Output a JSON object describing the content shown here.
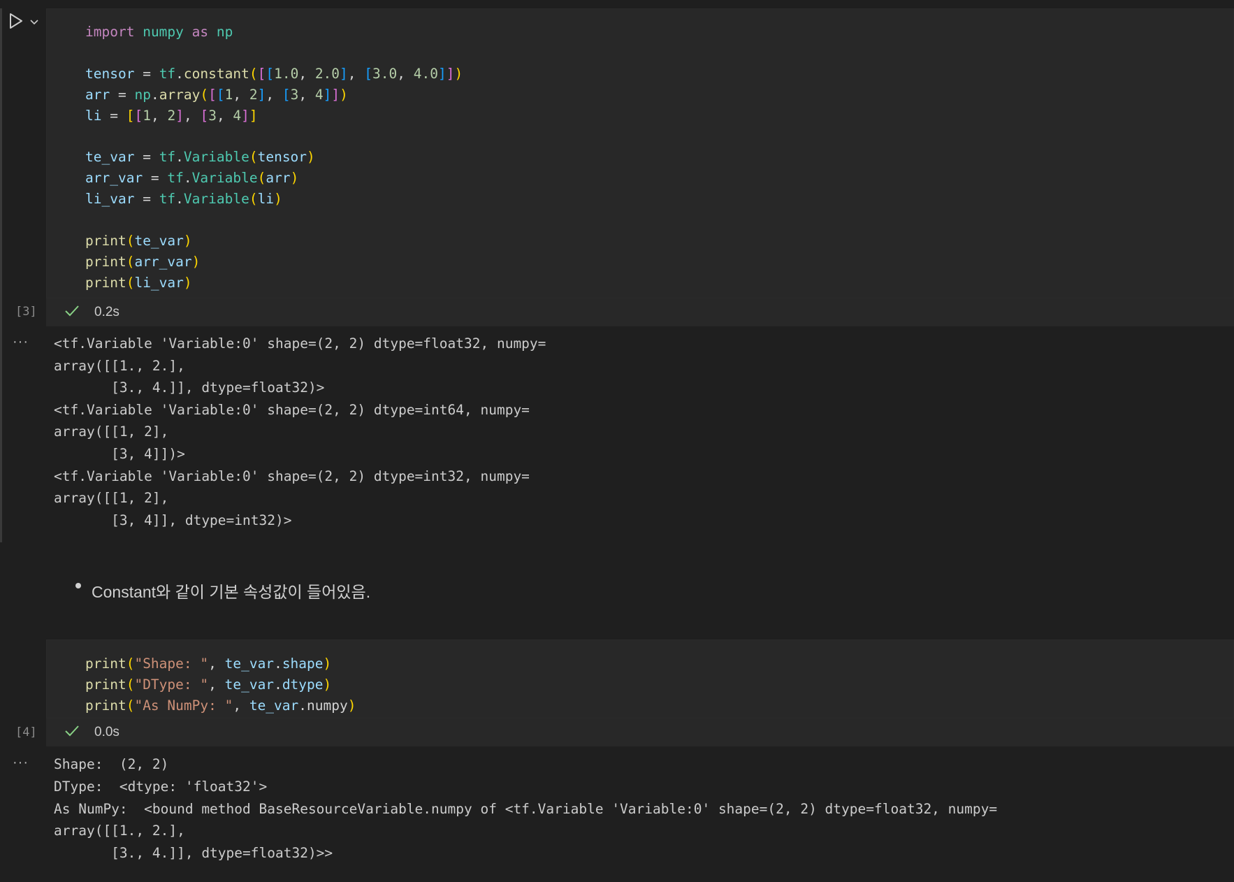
{
  "cell3": {
    "code": [
      {
        "segments": [
          [
            "kw",
            "import"
          ],
          [
            "op",
            " "
          ],
          [
            "mod",
            "numpy"
          ],
          [
            "op",
            " "
          ],
          [
            "kw",
            "as"
          ],
          [
            "op",
            " "
          ],
          [
            "mod",
            "np"
          ]
        ]
      },
      {
        "segments": []
      },
      {
        "segments": [
          [
            "var",
            "tensor"
          ],
          [
            "op",
            " = "
          ],
          [
            "mod",
            "tf"
          ],
          [
            "op",
            "."
          ],
          [
            "fn",
            "constant"
          ],
          [
            "b1",
            "("
          ],
          [
            "b2",
            "["
          ],
          [
            "b3",
            "["
          ],
          [
            "num",
            "1.0"
          ],
          [
            "op",
            ", "
          ],
          [
            "num",
            "2.0"
          ],
          [
            "b3",
            "]"
          ],
          [
            "op",
            ", "
          ],
          [
            "b3",
            "["
          ],
          [
            "num",
            "3.0"
          ],
          [
            "op",
            ", "
          ],
          [
            "num",
            "4.0"
          ],
          [
            "b3",
            "]"
          ],
          [
            "b2",
            "]"
          ],
          [
            "b1",
            ")"
          ]
        ]
      },
      {
        "segments": [
          [
            "var",
            "arr"
          ],
          [
            "op",
            " = "
          ],
          [
            "mod",
            "np"
          ],
          [
            "op",
            "."
          ],
          [
            "fn",
            "array"
          ],
          [
            "b1",
            "("
          ],
          [
            "b2",
            "["
          ],
          [
            "b3",
            "["
          ],
          [
            "num",
            "1"
          ],
          [
            "op",
            ", "
          ],
          [
            "num",
            "2"
          ],
          [
            "b3",
            "]"
          ],
          [
            "op",
            ", "
          ],
          [
            "b3",
            "["
          ],
          [
            "num",
            "3"
          ],
          [
            "op",
            ", "
          ],
          [
            "num",
            "4"
          ],
          [
            "b3",
            "]"
          ],
          [
            "b2",
            "]"
          ],
          [
            "b1",
            ")"
          ]
        ]
      },
      {
        "segments": [
          [
            "var",
            "li"
          ],
          [
            "op",
            " = "
          ],
          [
            "b1",
            "["
          ],
          [
            "b2",
            "["
          ],
          [
            "num",
            "1"
          ],
          [
            "op",
            ", "
          ],
          [
            "num",
            "2"
          ],
          [
            "b2",
            "]"
          ],
          [
            "op",
            ", "
          ],
          [
            "b2",
            "["
          ],
          [
            "num",
            "3"
          ],
          [
            "op",
            ", "
          ],
          [
            "num",
            "4"
          ],
          [
            "b2",
            "]"
          ],
          [
            "b1",
            "]"
          ]
        ]
      },
      {
        "segments": []
      },
      {
        "segments": [
          [
            "var",
            "te_var"
          ],
          [
            "op",
            " = "
          ],
          [
            "mod",
            "tf"
          ],
          [
            "op",
            "."
          ],
          [
            "mod",
            "Variable"
          ],
          [
            "b1",
            "("
          ],
          [
            "var",
            "tensor"
          ],
          [
            "b1",
            ")"
          ]
        ]
      },
      {
        "segments": [
          [
            "var",
            "arr_var"
          ],
          [
            "op",
            " = "
          ],
          [
            "mod",
            "tf"
          ],
          [
            "op",
            "."
          ],
          [
            "mod",
            "Variable"
          ],
          [
            "b1",
            "("
          ],
          [
            "var",
            "arr"
          ],
          [
            "b1",
            ")"
          ]
        ]
      },
      {
        "segments": [
          [
            "var",
            "li_var"
          ],
          [
            "op",
            " = "
          ],
          [
            "mod",
            "tf"
          ],
          [
            "op",
            "."
          ],
          [
            "mod",
            "Variable"
          ],
          [
            "b1",
            "("
          ],
          [
            "var",
            "li"
          ],
          [
            "b1",
            ")"
          ]
        ]
      },
      {
        "segments": []
      },
      {
        "segments": [
          [
            "fn",
            "print"
          ],
          [
            "b1",
            "("
          ],
          [
            "var",
            "te_var"
          ],
          [
            "b1",
            ")"
          ]
        ]
      },
      {
        "segments": [
          [
            "fn",
            "print"
          ],
          [
            "b1",
            "("
          ],
          [
            "var",
            "arr_var"
          ],
          [
            "b1",
            ")"
          ]
        ]
      },
      {
        "segments": [
          [
            "fn",
            "print"
          ],
          [
            "b1",
            "("
          ],
          [
            "var",
            "li_var"
          ],
          [
            "b1",
            ")"
          ]
        ]
      }
    ],
    "exec_count": "[3]",
    "duration": "0.2s",
    "output": [
      "<tf.Variable 'Variable:0' shape=(2, 2) dtype=float32, numpy=",
      "array([[1., 2.],",
      "       [3., 4.]], dtype=float32)>",
      "<tf.Variable 'Variable:0' shape=(2, 2) dtype=int64, numpy=",
      "array([[1, 2],",
      "       [3, 4]])>",
      "<tf.Variable 'Variable:0' shape=(2, 2) dtype=int32, numpy=",
      "array([[1, 2],",
      "       [3, 4]], dtype=int32)>"
    ]
  },
  "markdown": {
    "bullet": "Constant와 같이 기본 속성값이 들어있음."
  },
  "cell4": {
    "code": [
      {
        "segments": [
          [
            "fn",
            "print"
          ],
          [
            "b1",
            "("
          ],
          [
            "str",
            "\"Shape: \""
          ],
          [
            "op",
            ", "
          ],
          [
            "var",
            "te_var"
          ],
          [
            "op",
            "."
          ],
          [
            "var",
            "shape"
          ],
          [
            "b1",
            ")"
          ]
        ]
      },
      {
        "segments": [
          [
            "fn",
            "print"
          ],
          [
            "b1",
            "("
          ],
          [
            "str",
            "\"DType: \""
          ],
          [
            "op",
            ", "
          ],
          [
            "var",
            "te_var"
          ],
          [
            "op",
            "."
          ],
          [
            "var",
            "dtype"
          ],
          [
            "b1",
            ")"
          ]
        ]
      },
      {
        "segments": [
          [
            "fn",
            "print"
          ],
          [
            "b1",
            "("
          ],
          [
            "str",
            "\"As NumPy: \""
          ],
          [
            "op",
            ", "
          ],
          [
            "var",
            "te_var"
          ],
          [
            "op",
            "."
          ],
          [
            "op",
            "numpy"
          ],
          [
            "b1",
            ")"
          ]
        ]
      }
    ],
    "exec_count": "[4]",
    "duration": "0.0s",
    "output": [
      "Shape:  (2, 2)",
      "DType:  <dtype: 'float32'>",
      "As NumPy:  <bound method BaseResourceVariable.numpy of <tf.Variable 'Variable:0' shape=(2, 2) dtype=float32, numpy=",
      "array([[1., 2.],",
      "       [3., 4.]], dtype=float32)>>"
    ]
  },
  "icons": {
    "run": "play-icon",
    "expand": "chevron-down-icon",
    "success": "check-icon",
    "more": "ellipsis-icon"
  },
  "ui": {
    "more_glyph": "···"
  }
}
